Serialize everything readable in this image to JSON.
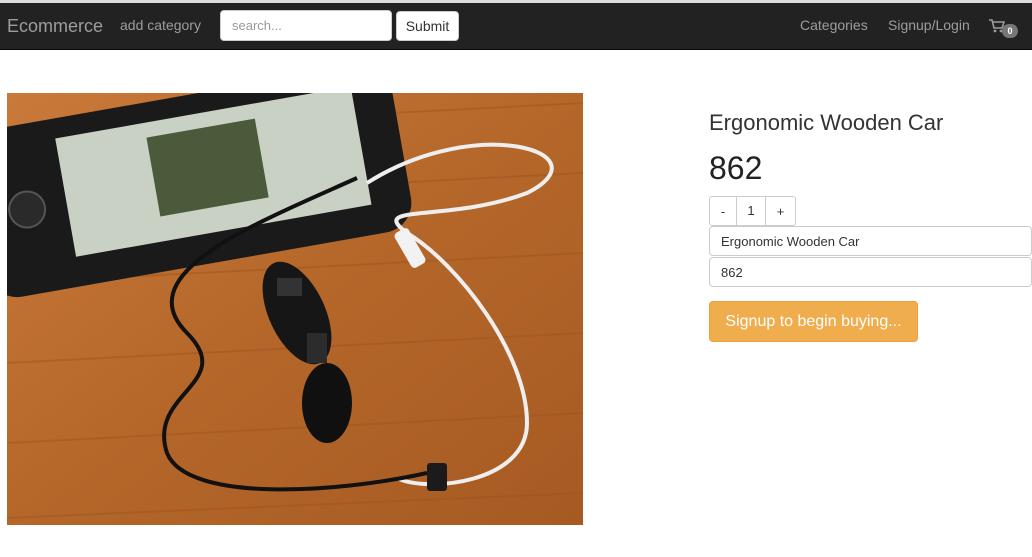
{
  "navbar": {
    "brand": "Ecommerce",
    "add_category": "add category",
    "search_placeholder": "search...",
    "submit_label": "Submit",
    "categories": "Categories",
    "signup_login": "Signup/Login",
    "cart_count": "0"
  },
  "product": {
    "title": "Ergonomic Wooden Car",
    "price": "862",
    "quantity": {
      "minus_label": "-",
      "value": "1",
      "plus_label": "+"
    },
    "name_field_value": "Ergonomic Wooden Car",
    "price_field_value": "862",
    "signup_button": "Signup to begin buying..."
  },
  "colors": {
    "navbar_bg": "#222222",
    "nav_text": "#9d9d9d",
    "warning_button": "#f0ad4e"
  }
}
